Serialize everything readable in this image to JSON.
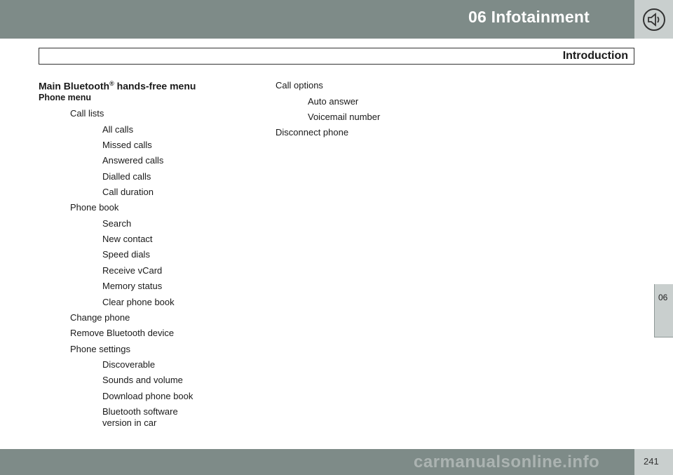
{
  "header": {
    "chapter": "06",
    "title": "Infotainment",
    "title_full": "06  Infotainment"
  },
  "section": {
    "title": "Introduction"
  },
  "side_tab": {
    "label": "06"
  },
  "page": {
    "number": "241"
  },
  "main": {
    "heading": "Main Bluetooth",
    "heading_mark": "®",
    "heading_rest": " hands-free menu",
    "subheading": "Phone menu",
    "left_items": [
      "Call lists",
      "All calls",
      "Missed calls",
      "Answered calls",
      "Dialled calls",
      "Call duration",
      "Phone book",
      "Search",
      "New contact",
      "Speed dials",
      "Receive vCard",
      "Memory status",
      "Clear phone book",
      "Change phone",
      "Remove Bluetooth device",
      "Phone settings",
      "Discoverable",
      "Sounds and volume",
      "Download phone book",
      "Bluetooth software",
      "version in car"
    ],
    "right_items": [
      "Call options",
      "Auto answer",
      "Voicemail number",
      "Disconnect phone"
    ]
  },
  "watermark": "carmanualsonline.info",
  "colors": {
    "header_bg": "#7e8b88",
    "tab_bg": "#c9cfce"
  }
}
